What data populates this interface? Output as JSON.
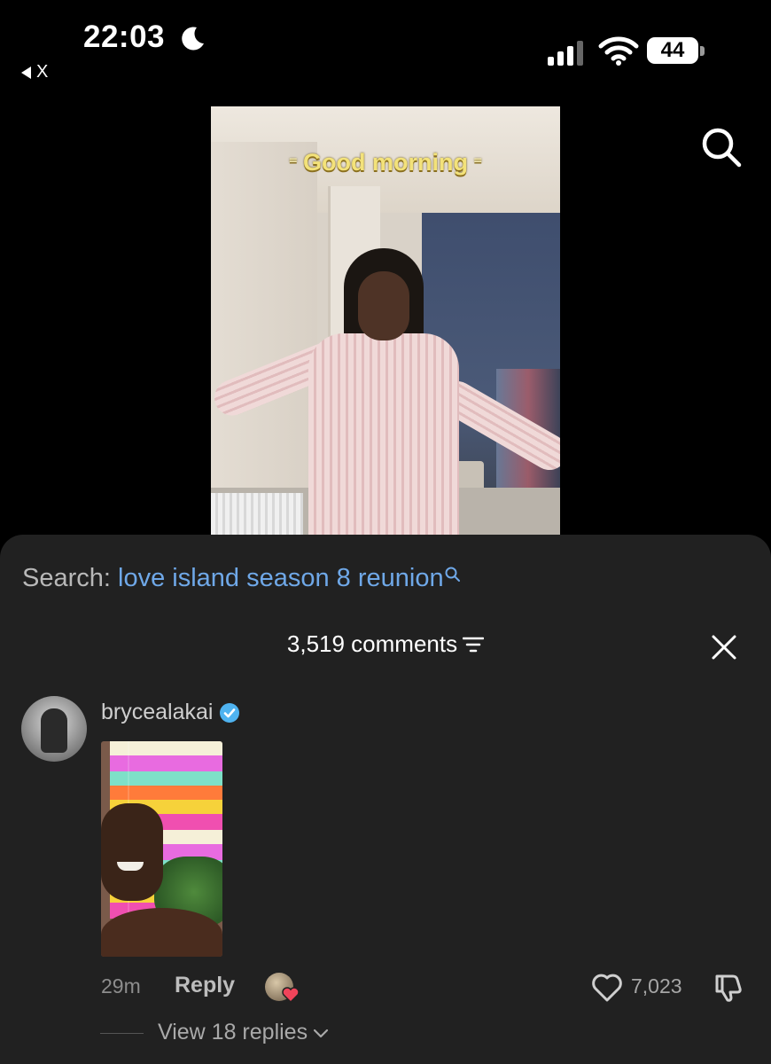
{
  "status_bar": {
    "time": "22:03",
    "back_label": "X",
    "battery": "44"
  },
  "video": {
    "caption": "Good morning"
  },
  "comments_sheet": {
    "search_prefix": "Search:",
    "search_query": "love island season 8 reunion",
    "comment_count": "3,519 comments",
    "comments": [
      {
        "username": "brycealakai",
        "verified": true,
        "time": "29m",
        "reply_label": "Reply",
        "likes": "7,023",
        "view_replies": "View 18 replies"
      }
    ]
  },
  "colors": {
    "background": "#000000",
    "sheet": "#212121",
    "search_query": "#6fa8e8",
    "caption": "#f3e27a",
    "verified": "#4fb3f0",
    "liked_heart": "#f0445a"
  },
  "icons": [
    "moon-icon",
    "signal-icon",
    "wifi-icon",
    "battery-icon",
    "search-icon",
    "filter-icon",
    "close-icon",
    "verified-icon",
    "heart-icon",
    "dislike-icon",
    "chevron-down-icon"
  ]
}
